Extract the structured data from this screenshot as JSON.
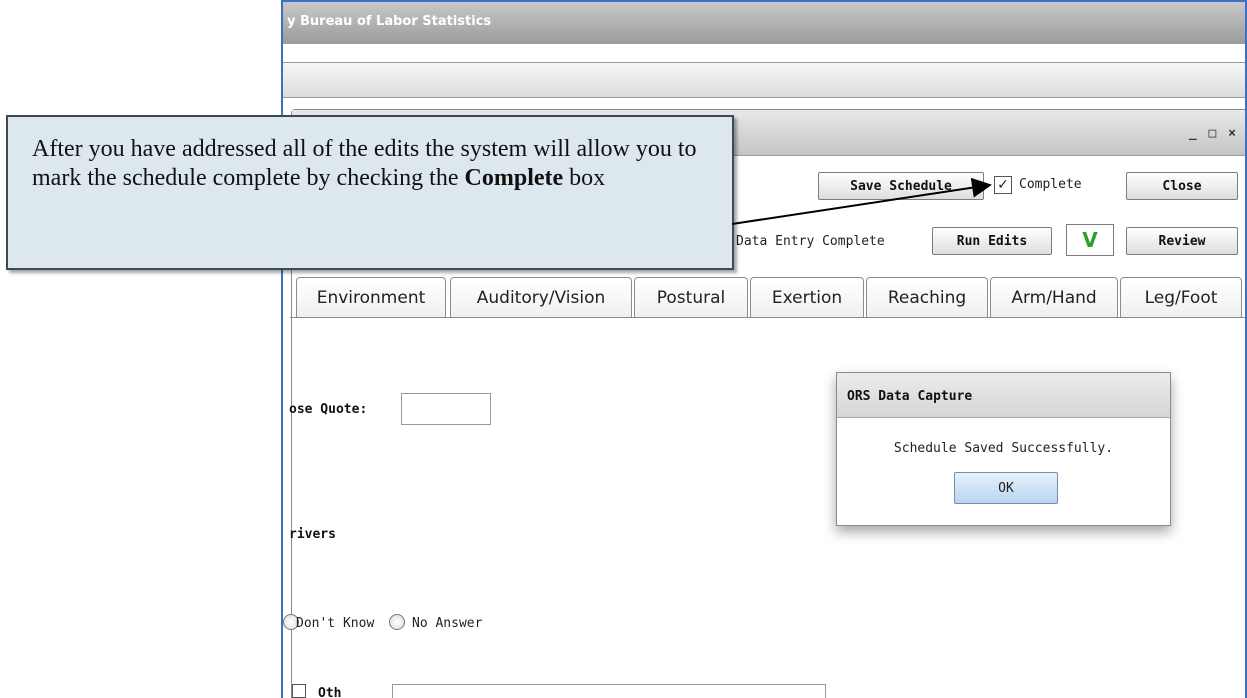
{
  "browser": {
    "title_text": "y Bureau of Labor Statistics"
  },
  "window_controls": {
    "minimize": "_",
    "maximize": "□",
    "close": "×"
  },
  "toolbar": {
    "save_label": "Save Schedule",
    "complete_label": "Complete",
    "complete_checked": true,
    "close_label": "Close",
    "data_entry_label": "Data Entry Complete",
    "run_edits_label": "Run Edits",
    "status_value": "V",
    "review_label": "Review"
  },
  "tabs": [
    {
      "label": "Environment"
    },
    {
      "label": "Auditory/Vision"
    },
    {
      "label": "Postural"
    },
    {
      "label": "Exertion"
    },
    {
      "label": "Reaching"
    },
    {
      "label": "Arm/Hand"
    },
    {
      "label": "Leg/Foot"
    }
  ],
  "form": {
    "quote_label": "ose Quote:",
    "quote_value": "",
    "drivers_label": "rivers",
    "radio_dont_know": "Don't Know",
    "radio_no_answer": "No Answer",
    "other_label": "Oth"
  },
  "dialog": {
    "title": "ORS Data Capture",
    "message": "Schedule Saved Successfully.",
    "ok_label": "OK"
  },
  "callout": {
    "text_before": "After you have addressed all of the edits the system will allow you to mark the schedule complete by checking the ",
    "bold_word": "Complete",
    "text_after": " box"
  },
  "colors": {
    "frame_border": "#3b70c4",
    "status_v": "#2aa12a",
    "callout_bg": "#dde8ee"
  }
}
